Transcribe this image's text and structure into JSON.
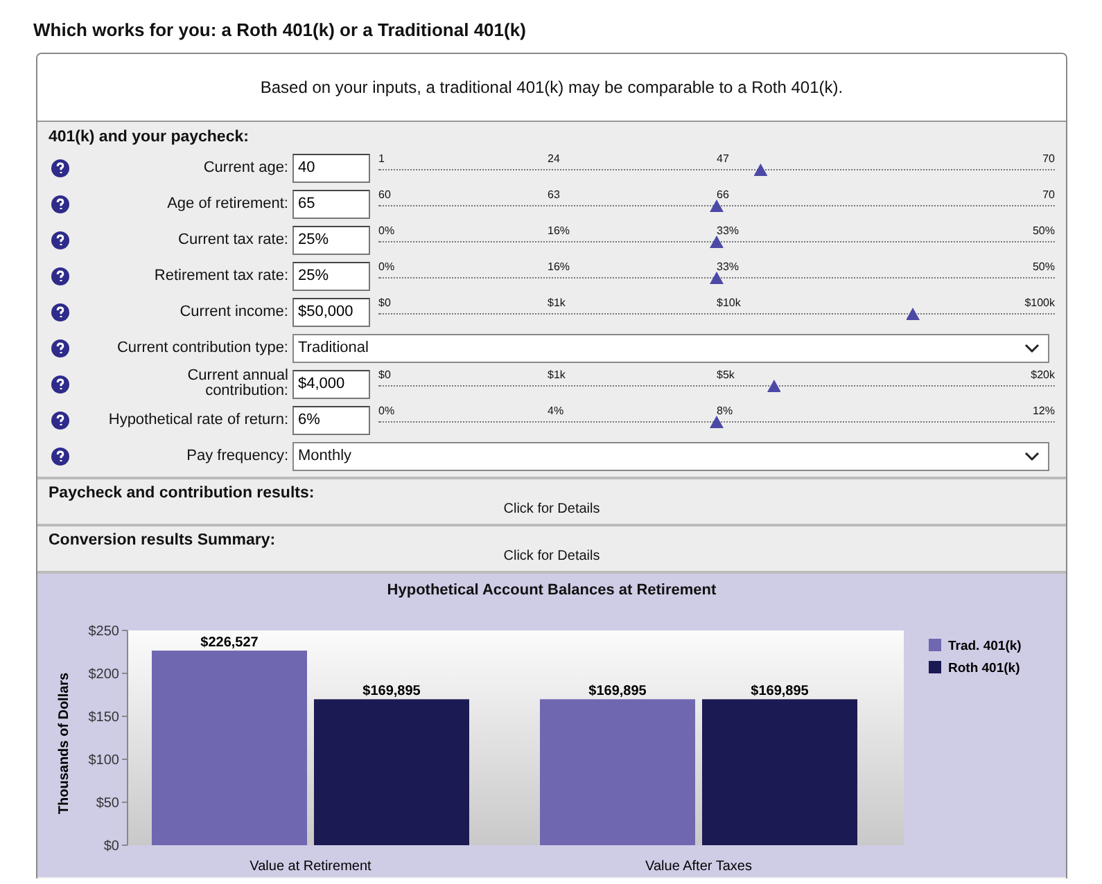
{
  "page_title": "Which works for you: a Roth 401(k) or a Traditional 401(k)",
  "summary": "Based on your inputs, a traditional 401(k) may be comparable to a Roth 401(k).",
  "inputs": {
    "heading": "401(k) and your paycheck:",
    "rows": [
      {
        "kind": "slider",
        "label": "Current age:",
        "value": "40",
        "ticks": [
          "1",
          "24",
          "47",
          "70"
        ],
        "level": 0.565
      },
      {
        "kind": "slider",
        "label": "Age of retirement:",
        "value": "65",
        "ticks": [
          "60",
          "63",
          "66",
          "70"
        ],
        "level": 0.5
      },
      {
        "kind": "slider",
        "label": "Current tax rate:",
        "value": "25%",
        "ticks": [
          "0%",
          "16%",
          "33%",
          "50%"
        ],
        "level": 0.5
      },
      {
        "kind": "slider",
        "label": "Retirement tax rate:",
        "value": "25%",
        "ticks": [
          "0%",
          "16%",
          "33%",
          "50%"
        ],
        "level": 0.5
      },
      {
        "kind": "slider",
        "label": "Current income:",
        "value": "$50,000",
        "ticks": [
          "$0",
          "$1k",
          "$10k",
          "$100k"
        ],
        "level": 0.79
      },
      {
        "kind": "select",
        "label": "Current contribution type:",
        "value": "Traditional"
      },
      {
        "kind": "slider",
        "label": "Current annual\ncontribution:",
        "value": "$4,000",
        "ticks": [
          "$0",
          "$1k",
          "$5k",
          "$20k"
        ],
        "level": 0.585
      },
      {
        "kind": "slider",
        "label": "Hypothetical rate of return:",
        "value": "6%",
        "ticks": [
          "0%",
          "4%",
          "8%",
          "12%"
        ],
        "level": 0.5
      },
      {
        "kind": "select",
        "label": "Pay frequency:",
        "value": "Monthly"
      }
    ]
  },
  "results": [
    {
      "title": "Paycheck and contribution results:",
      "link": "Click for Details"
    },
    {
      "title": "Conversion results Summary:",
      "link": "Click for Details"
    }
  ],
  "chart": {
    "chart_data": {
      "type": "bar",
      "title": "Hypothetical Account Balances at Retirement",
      "ylabel": "Thousands of Dollars",
      "categories": [
        "Value at Retirement",
        "Value After Taxes"
      ],
      "series": [
        {
          "name": "Trad. 401(k)",
          "color": "#6f67b0",
          "values": [
            226.527,
            169.895
          ]
        },
        {
          "name": "Roth 401(k)",
          "color": "#1c1a52",
          "values": [
            169.895,
            169.895
          ]
        }
      ],
      "legend": true,
      "ylim": [
        0,
        250
      ],
      "yticks": [
        {
          "value": 0,
          "label": "$0"
        },
        {
          "value": 50,
          "label": "$50"
        },
        {
          "value": 100,
          "label": "$100"
        },
        {
          "value": 150,
          "label": "$150"
        },
        {
          "value": 200,
          "label": "$200"
        },
        {
          "value": 250,
          "label": "$250"
        }
      ],
      "value_labels": [
        [
          "$226,527",
          "$169,895"
        ],
        [
          "$169,895",
          "$169,895"
        ]
      ]
    }
  }
}
